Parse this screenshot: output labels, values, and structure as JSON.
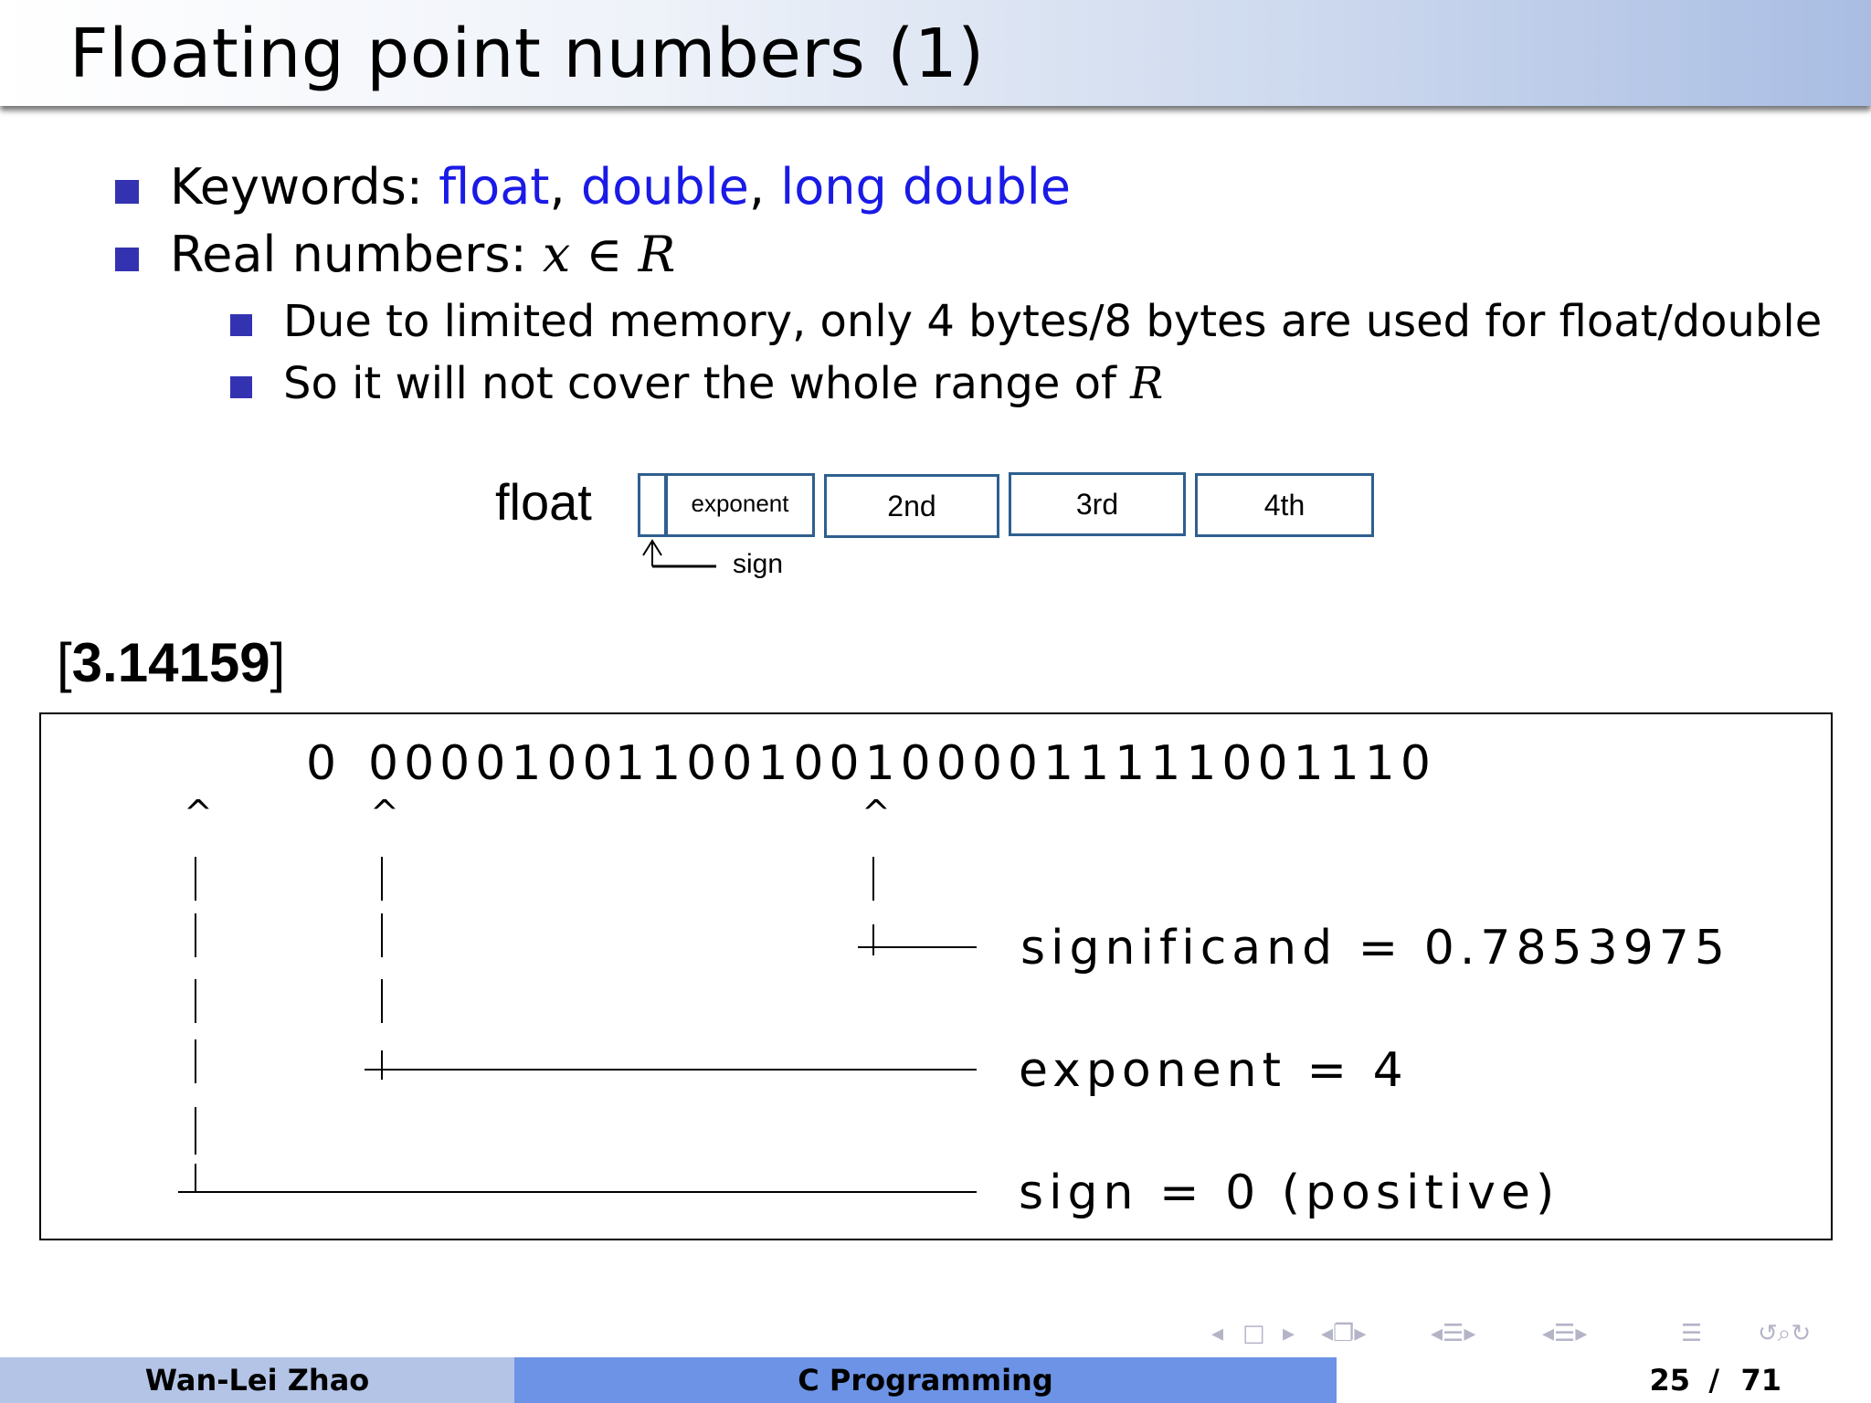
{
  "slide": {
    "title": "Floating point numbers (1)",
    "bullets": [
      {
        "prefix": "Keywords: ",
        "kw1": "float",
        "sep1": ", ",
        "kw2": "double",
        "sep2": ", ",
        "kw3": "long double"
      },
      {
        "prefix": "Real numbers: ",
        "math": "x ∈ R"
      }
    ],
    "subbullets": [
      {
        "text": "Due to limited memory, only 4 bytes/8 bytes are used for float/double"
      },
      {
        "text": "So it will not cover the whole range of ",
        "math": "R"
      }
    ]
  },
  "float_diagram": {
    "label": "float",
    "bytes": [
      "exponent",
      "2nd",
      "3rd",
      "4th"
    ],
    "sign_label": "sign"
  },
  "example": {
    "value": "3.14159",
    "bracket_open": "[",
    "bracket_close": "]",
    "bits": {
      "sign": "0",
      "exponent": "0000100",
      "significand": "11001001000011111001110"
    },
    "caret": "^",
    "significand_text": "significand = 0.7853975",
    "exponent_text": "exponent = 4",
    "sign_text": "sign = 0 (positive)"
  },
  "footer": {
    "author": "Wan-Lei Zhao",
    "course": "C Programming",
    "page_current": "25",
    "page_sep": "/",
    "page_total": "71"
  },
  "colors": {
    "bullet": "#3333b2",
    "keyword": "#1a1ae6",
    "footer_left": "#b3c4e6",
    "footer_mid": "#6c93e6",
    "footer_right": "#ffffff",
    "box_border": "#2f5f8f"
  },
  "nav_icons": [
    "nav-prev-slide-icon",
    "nav-slide-icon",
    "nav-next-slide-icon",
    "nav-frame-icon",
    "nav-section-icon",
    "nav-subsection-icon",
    "nav-outline-icon",
    "nav-search-icon"
  ]
}
